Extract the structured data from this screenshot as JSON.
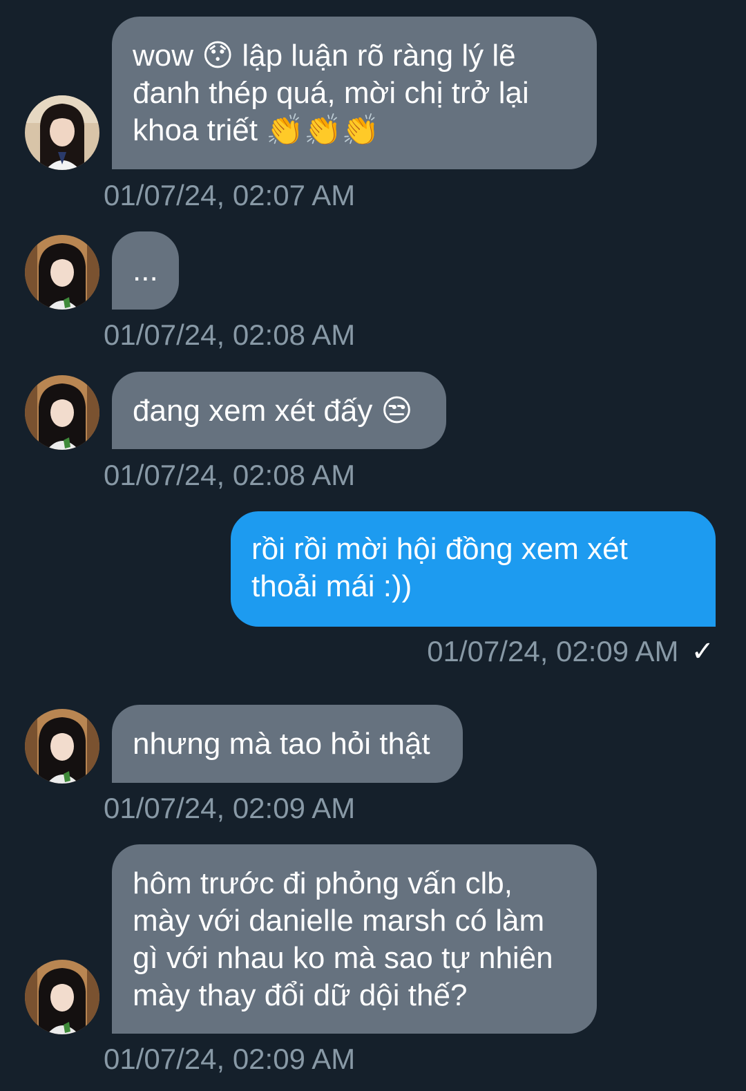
{
  "messages": [
    {
      "direction": "incoming",
      "text": "wow 😯 lập luận rõ ràng lý lẽ đanh thép quá, mời chị trở lại khoa triết 👏👏👏",
      "timestamp": "01/07/24, 02:07 AM"
    },
    {
      "direction": "incoming",
      "text": "...",
      "timestamp": "01/07/24, 02:08 AM"
    },
    {
      "direction": "incoming",
      "text": "đang xem xét đấy 😒",
      "timestamp": "01/07/24, 02:08 AM"
    },
    {
      "direction": "outgoing",
      "text": "rồi rồi mời hội đồng xem xét thoải mái :))",
      "timestamp": "01/07/24, 02:09 AM",
      "status_icon": "checkmark-icon",
      "status_glyph": "✓"
    },
    {
      "direction": "incoming",
      "text": "nhưng mà tao hỏi thật",
      "timestamp": "01/07/24, 02:09 AM"
    },
    {
      "direction": "incoming",
      "text": "hôm trước đi phỏng vấn clb, mày với danielle marsh có làm gì với nhau ko mà sao tự nhiên mày thay đổi dữ dội thế?",
      "timestamp": "01/07/24, 02:09 AM"
    }
  ],
  "colors": {
    "background": "#15202b",
    "incoming_bubble": "#66727f",
    "outgoing_bubble": "#1d9bf0",
    "timestamp": "#8899a6"
  }
}
